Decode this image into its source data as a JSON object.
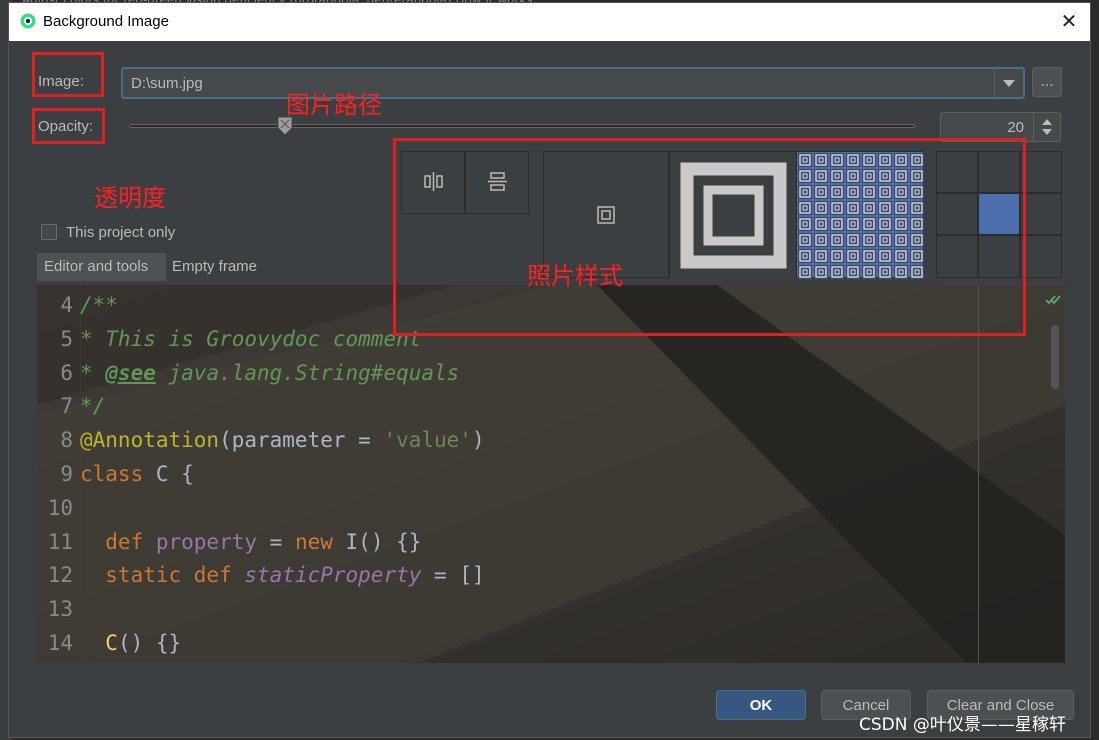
{
  "background": {
    "top_text": "Adjust colors for red-green vision deficiency (protanopia, deuteranopia)  How it works"
  },
  "dialog": {
    "title": "Background Image",
    "image_label": "Image:",
    "image_path": "D:\\sum.jpg",
    "browse_label": "...",
    "opacity_label": "Opacity:",
    "opacity_value": "20",
    "opacity_fraction": 0.2,
    "this_project_only_label": "This project only",
    "this_project_only_checked": false,
    "tabs": [
      {
        "label": "Editor and tools",
        "active": true
      },
      {
        "label": "Empty frame",
        "active": false
      }
    ],
    "buttons": {
      "ok": "OK",
      "cancel": "Cancel",
      "clear_close": "Clear and Close"
    }
  },
  "annotations": {
    "image_path": "图片路径",
    "opacity": "透明度",
    "photo_style": "照片样式"
  },
  "editor": {
    "lines": [
      {
        "num": "4",
        "tokens": [
          {
            "t": "/**",
            "c": "c-comment"
          }
        ]
      },
      {
        "num": "5",
        "tokens": [
          {
            "t": "* This is Groovydoc comment",
            "c": "c-comment"
          }
        ]
      },
      {
        "num": "6",
        "tokens": [
          {
            "t": "* ",
            "c": "c-comment"
          },
          {
            "t": "@see",
            "c": "c-tag"
          },
          {
            "t": " java.lang.String#equals",
            "c": "c-comment"
          }
        ]
      },
      {
        "num": "7",
        "tokens": [
          {
            "t": "*/",
            "c": "c-comment"
          }
        ]
      },
      {
        "num": "8",
        "tokens": [
          {
            "t": "@Annotation",
            "c": "c-ann"
          },
          {
            "t": "(parameter = ",
            "c": "c-plain"
          },
          {
            "t": "'value'",
            "c": "c-str"
          },
          {
            "t": ")",
            "c": "c-plain"
          }
        ]
      },
      {
        "num": "9",
        "tokens": [
          {
            "t": "class",
            "c": "c-kw"
          },
          {
            "t": " C {",
            "c": "c-plain"
          }
        ]
      },
      {
        "num": "10",
        "tokens": []
      },
      {
        "num": "11",
        "tokens": [
          {
            "t": "  def ",
            "c": "c-kw"
          },
          {
            "t": "property",
            "c": "c-prop"
          },
          {
            "t": " = ",
            "c": "c-plain"
          },
          {
            "t": "new",
            "c": "c-kw"
          },
          {
            "t": " I() {}",
            "c": "c-plain"
          }
        ]
      },
      {
        "num": "12",
        "tokens": [
          {
            "t": "  static def ",
            "c": "c-kw"
          },
          {
            "t": "staticProperty",
            "c": "c-prop-i"
          },
          {
            "t": " = []",
            "c": "c-plain"
          }
        ]
      },
      {
        "num": "13",
        "tokens": []
      },
      {
        "num": "14",
        "tokens": [
          {
            "t": "  C",
            "c": "c-fn"
          },
          {
            "t": "() {}",
            "c": "c-plain"
          }
        ]
      }
    ]
  },
  "watermark": "CSDN @叶仪景——星稼轩",
  "colors": {
    "accent": "#466d94",
    "ok_button": "#365880",
    "annotation_red": "#e02020",
    "selected_tile": "#4b6eaf"
  }
}
